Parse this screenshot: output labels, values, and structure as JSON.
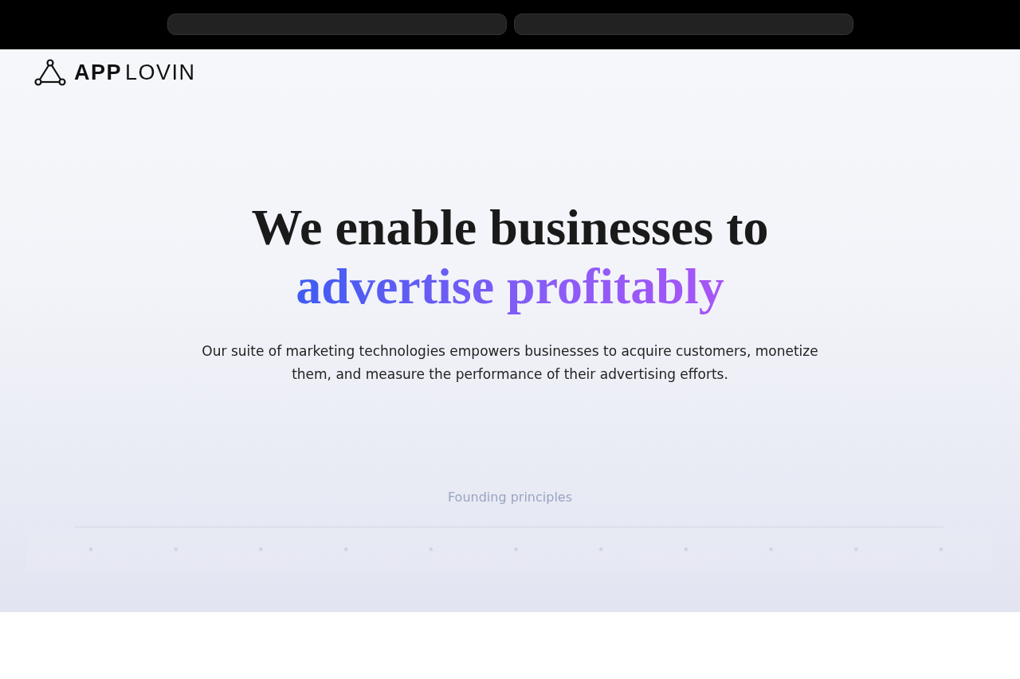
{
  "logo": {
    "bold": "APP",
    "light": "LOVIN"
  },
  "hero": {
    "heading_line1": "We enable businesses to",
    "heading_line2": "advertise profitably",
    "subtitle": "Our suite of marketing technologies empowers businesses to acquire customers, monetize them, and measure the performance of their advertising efforts."
  },
  "principles": {
    "label": "Founding principles"
  }
}
